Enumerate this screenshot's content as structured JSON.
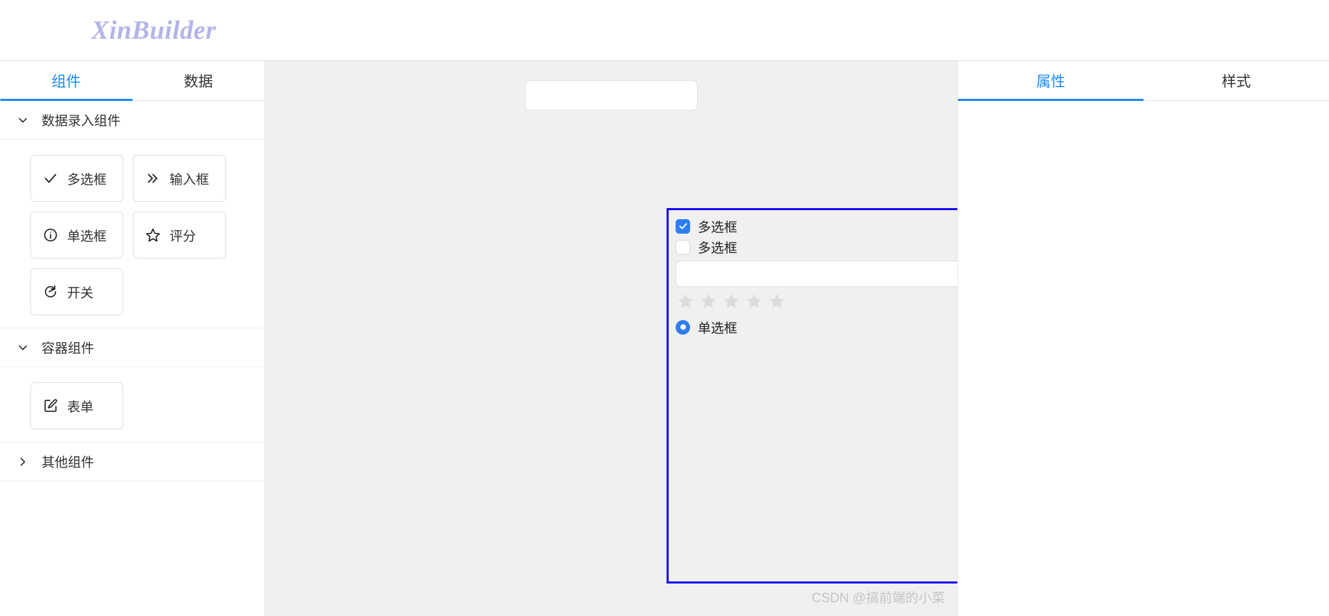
{
  "header": {
    "logo": "XinBuilder"
  },
  "left_panel": {
    "tabs": [
      {
        "label": "组件",
        "active": true
      },
      {
        "label": "数据",
        "active": false
      }
    ],
    "sections": [
      {
        "title": "数据录入组件",
        "expanded": true,
        "items": [
          {
            "label": "多选框",
            "icon": "check-icon"
          },
          {
            "label": "输入框",
            "icon": "double-chevron-right-icon"
          },
          {
            "label": "单选框",
            "icon": "info-circle-icon"
          },
          {
            "label": "评分",
            "icon": "star-outline-icon"
          },
          {
            "label": "开关",
            "icon": "login-arrow-icon"
          }
        ]
      },
      {
        "title": "容器组件",
        "expanded": true,
        "items": [
          {
            "label": "表单",
            "icon": "edit-square-icon"
          }
        ]
      },
      {
        "title": "其他组件",
        "expanded": false,
        "items": []
      }
    ]
  },
  "canvas": {
    "toolbar_input": {
      "value": "",
      "placeholder": ""
    },
    "form": {
      "selected": true,
      "border_color": "#1500f5",
      "fields": [
        {
          "type": "checkbox",
          "label": "多选框",
          "checked": true
        },
        {
          "type": "checkbox",
          "label": "多选框",
          "checked": false
        },
        {
          "type": "input",
          "value": "",
          "placeholder": ""
        },
        {
          "type": "rate",
          "stars": 5,
          "value": 0,
          "empty_color": "#dcdcdc"
        },
        {
          "type": "radio",
          "label": "单选框",
          "checked": true
        }
      ]
    },
    "watermark": "CSDN @搞前端的小菜"
  },
  "right_panel": {
    "tabs": [
      {
        "label": "属性",
        "active": true
      },
      {
        "label": "样式",
        "active": false
      }
    ]
  },
  "colors": {
    "accent": "#1989fa",
    "control_blue": "#2f7ef0",
    "selection_blue": "#1500f5",
    "logo_purple": "#b3b5e8",
    "canvas_bg": "#f0f0f0"
  }
}
